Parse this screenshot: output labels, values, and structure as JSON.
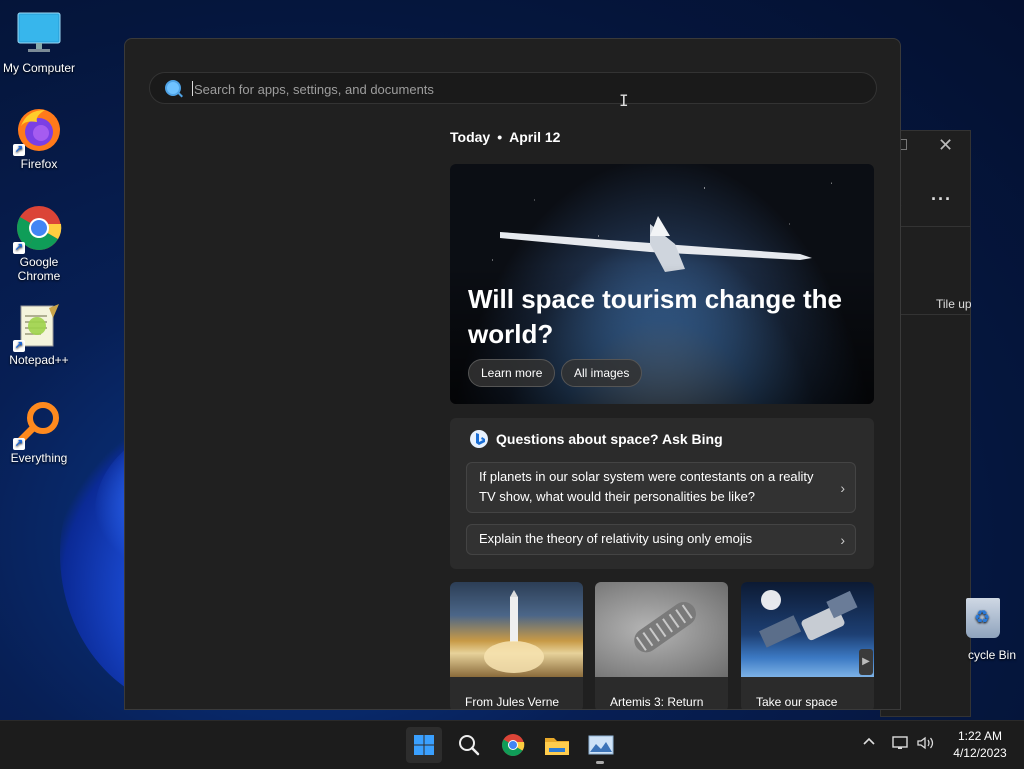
{
  "desktop": {
    "icons": [
      {
        "label": "My Computer"
      },
      {
        "label": "Firefox"
      },
      {
        "label": "Google Chrome"
      },
      {
        "label": "Notepad++"
      },
      {
        "label": "Everything"
      }
    ],
    "recycle_bin": "cycle Bin"
  },
  "background_window": {
    "tile_label": "Tile up"
  },
  "search": {
    "placeholder": "Search for apps, settings, and documents"
  },
  "feed": {
    "today": "Today",
    "date": "April 12",
    "hero": {
      "title": "Will space tourism change the world?",
      "learn_more": "Learn more",
      "all_images": "All images"
    },
    "bing": {
      "heading": "Questions about space? Ask Bing",
      "questions": [
        "If planets in our solar system were contestants on a reality TV show, what would their personalities be like?",
        "Explain the theory of relativity using only emojis"
      ]
    },
    "cards": [
      {
        "label": "From Jules Verne"
      },
      {
        "label": "Artemis 3: Return"
      },
      {
        "label": "Take our space"
      }
    ]
  },
  "taskbar": {
    "clock_time": "1:22 AM",
    "clock_date": "4/12/2023"
  },
  "colors": {
    "panel_bg": "#202020",
    "taskbar_bg": "#1c1c1c",
    "accent": "#4fa3e6"
  }
}
